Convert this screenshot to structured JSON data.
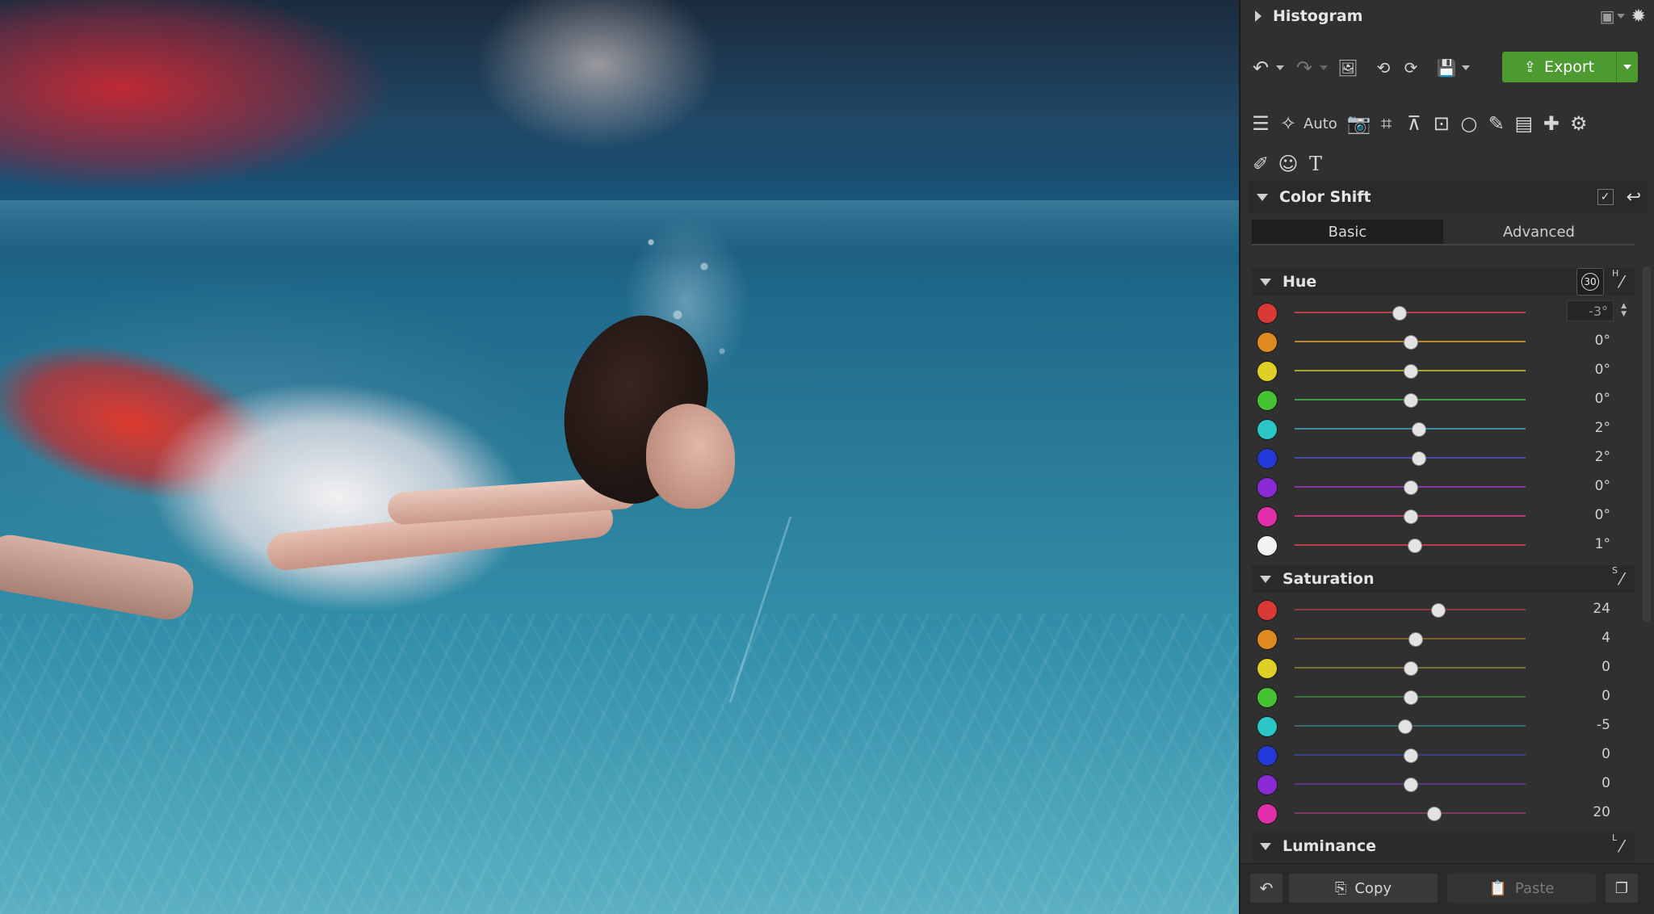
{
  "panel": {
    "histogram_title": "Histogram",
    "export_label": "Export",
    "auto_label": "Auto",
    "color_shift_title": "Color Shift",
    "tabs": [
      {
        "label": "Basic",
        "active": true
      },
      {
        "label": "Advanced",
        "active": false
      }
    ],
    "hue": {
      "title": "Hue",
      "badge": "30",
      "picker_letter": "H",
      "rows": [
        {
          "color": "#d93a35",
          "track": "#b8443f",
          "value": -3,
          "label": "-3°",
          "editing": true
        },
        {
          "color": "#de8a1f",
          "track": "#b28a2a",
          "value": 0,
          "label": "0°"
        },
        {
          "color": "#e2cf23",
          "track": "#a7a72a",
          "value": 0,
          "label": "0°"
        },
        {
          "color": "#45c332",
          "track": "#3f9c49",
          "value": 0,
          "label": "0°"
        },
        {
          "color": "#2cc7c4",
          "track": "#3a8ca0",
          "value": 2,
          "label": "2°"
        },
        {
          "color": "#2338d4",
          "track": "#4a4ab3",
          "value": 2,
          "label": "2°"
        },
        {
          "color": "#8b2bd6",
          "track": "#8a3aa8",
          "value": 0,
          "label": "0°"
        },
        {
          "color": "#e02fa8",
          "track": "#b53b6e",
          "value": 0,
          "label": "0°"
        },
        {
          "color": "#f2f2f2",
          "track": "#b9413e",
          "value": 1,
          "label": "1°"
        }
      ]
    },
    "saturation": {
      "title": "Saturation",
      "picker_letter": "S",
      "rows": [
        {
          "color": "#d93a35",
          "track": "#8a3b3b",
          "value": 24,
          "label": "24"
        },
        {
          "color": "#de8a1f",
          "track": "#7d5f30",
          "value": 4,
          "label": "4"
        },
        {
          "color": "#e2cf23",
          "track": "#77722f",
          "value": 0,
          "label": "0"
        },
        {
          "color": "#45c332",
          "track": "#3f7040",
          "value": 0,
          "label": "0"
        },
        {
          "color": "#2cc7c4",
          "track": "#3a6e70",
          "value": -5,
          "label": "-5"
        },
        {
          "color": "#2338d4",
          "track": "#3b3f86",
          "value": 0,
          "label": "0"
        },
        {
          "color": "#8b2bd6",
          "track": "#5d3783",
          "value": 0,
          "label": "0"
        },
        {
          "color": "#e02fa8",
          "track": "#7d3a63",
          "value": 20,
          "label": "20"
        }
      ]
    },
    "luminance_title": "Luminance",
    "luminance_picker_letter": "L",
    "copy_label": "Copy",
    "paste_label": "Paste"
  }
}
